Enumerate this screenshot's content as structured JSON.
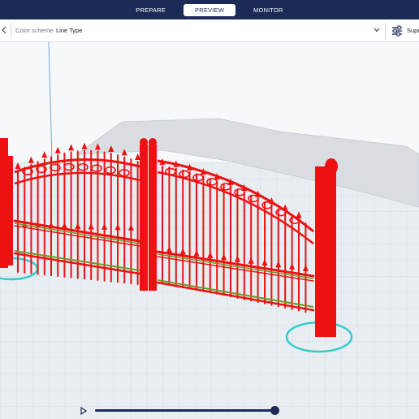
{
  "stages": {
    "prepare": "PREPARE",
    "preview": "PREVIEW",
    "monitor": "MONITOR"
  },
  "toolbar": {
    "color_scheme_label": "Color scheme",
    "color_scheme_value": "Line Type",
    "settings_label": "Supe"
  },
  "colors": {
    "header": "#1b2a57",
    "model": "#ee1111",
    "support": "#33cccc",
    "infill": "#6a9a2a"
  },
  "slider": {
    "progress": 1.0
  }
}
